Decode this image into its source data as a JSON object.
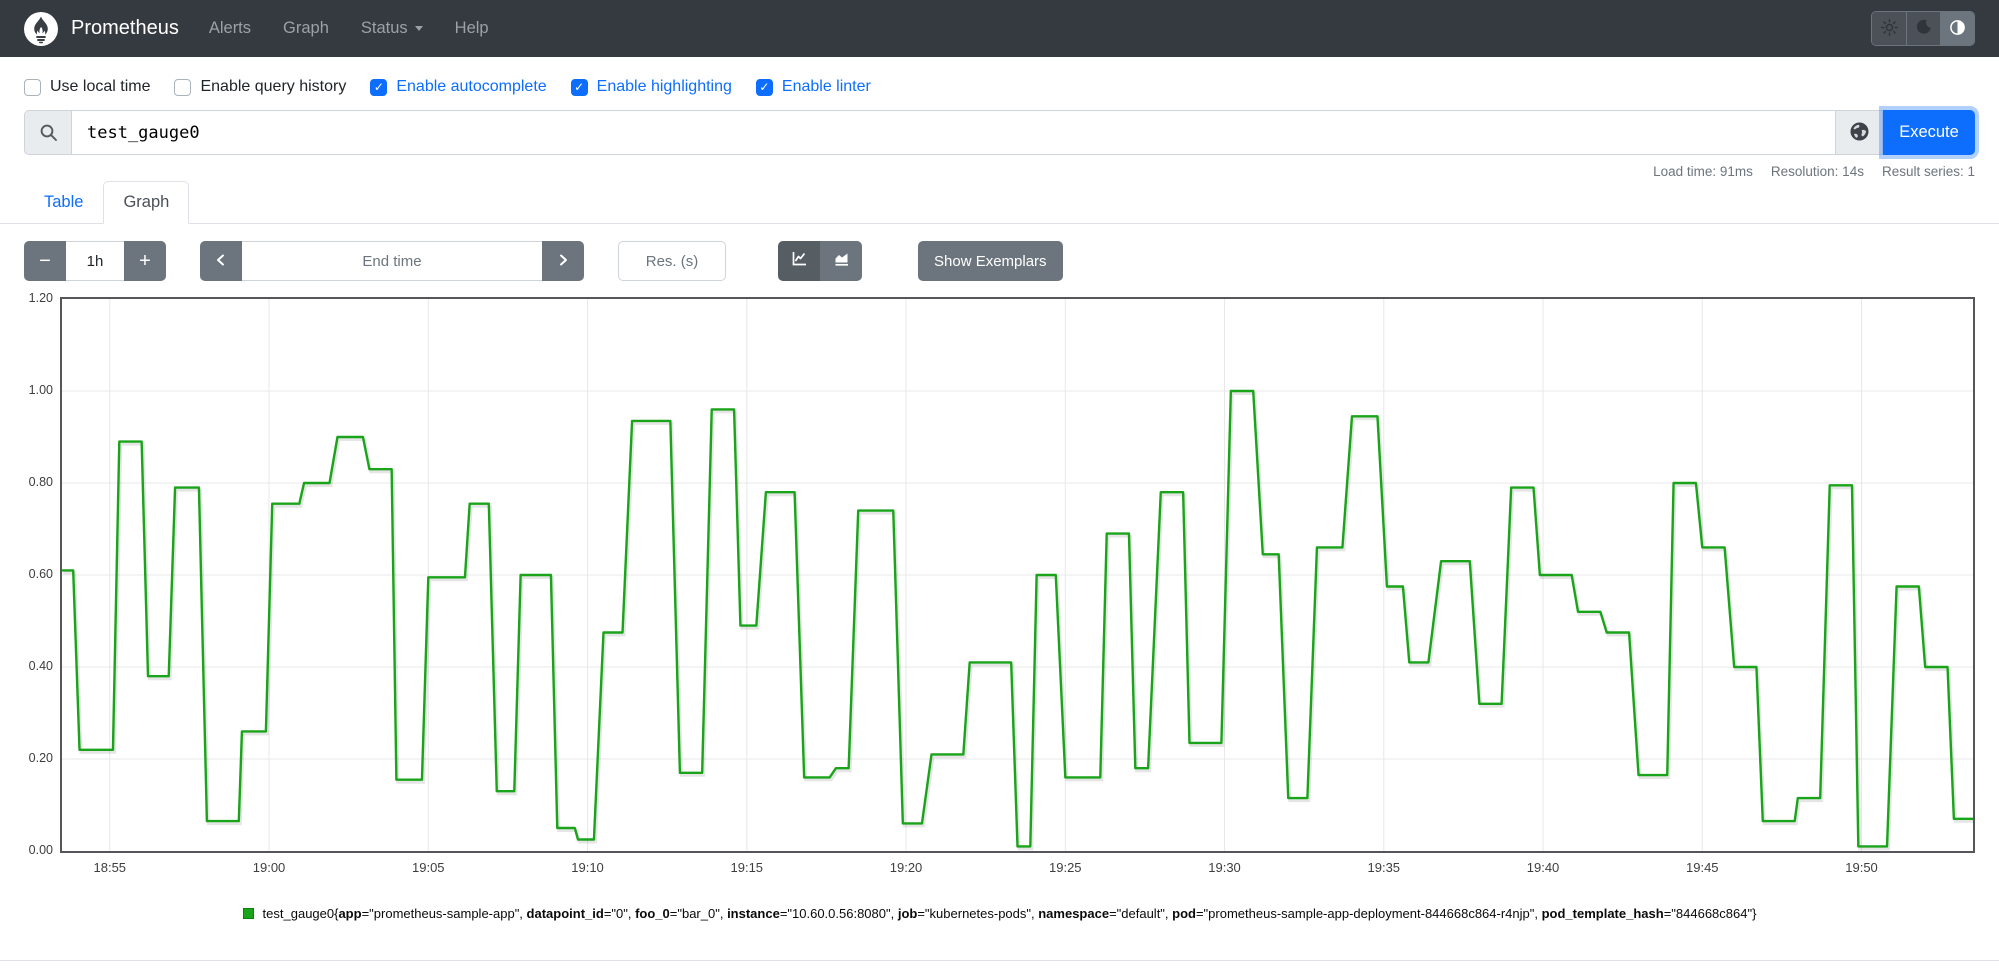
{
  "navbar": {
    "brand": "Prometheus",
    "links": [
      {
        "label": "Alerts",
        "has_caret": false
      },
      {
        "label": "Graph",
        "has_caret": false
      },
      {
        "label": "Status",
        "has_caret": true
      },
      {
        "label": "Help",
        "has_caret": false
      }
    ],
    "theme_buttons": [
      {
        "name": "light",
        "icon": "sun-icon",
        "active": false
      },
      {
        "name": "dark",
        "icon": "moon-icon",
        "active": false
      },
      {
        "name": "auto",
        "icon": "circle-half-icon",
        "active": true
      }
    ]
  },
  "options": {
    "items": [
      {
        "label": "Use local time",
        "checked": false
      },
      {
        "label": "Enable query history",
        "checked": false
      },
      {
        "label": "Enable autocomplete",
        "checked": true
      },
      {
        "label": "Enable highlighting",
        "checked": true
      },
      {
        "label": "Enable linter",
        "checked": true
      }
    ]
  },
  "query": {
    "value": "test_gauge0",
    "execute_label": "Execute"
  },
  "stats": {
    "load_time": "Load time: 91ms",
    "resolution": "Resolution: 14s",
    "result_series": "Result series: 1"
  },
  "tabs": [
    {
      "label": "Table",
      "active": false
    },
    {
      "label": "Graph",
      "active": true
    }
  ],
  "graph_controls": {
    "duration": "1h",
    "end_time_placeholder": "End time",
    "res_placeholder": "Res. (s)",
    "show_exemplars_label": "Show Exemplars"
  },
  "chart_data": {
    "type": "line",
    "line_style": "step-like gauge samples, linear interpolation",
    "line_color": "#1aa41a",
    "grid": true,
    "ylim": [
      0,
      1.2
    ],
    "y_ticks": [
      {
        "label": "0.00",
        "value": 0.0
      },
      {
        "label": "0.20",
        "value": 0.2
      },
      {
        "label": "0.40",
        "value": 0.4
      },
      {
        "label": "0.60",
        "value": 0.6
      },
      {
        "label": "0.80",
        "value": 0.8
      },
      {
        "label": "1.00",
        "value": 1.0
      },
      {
        "label": "1.20",
        "value": 1.2
      }
    ],
    "window_minutes": 60,
    "x_window_note": "1h window, left edge ~18:53.5, right edge ~19:53.5",
    "x_ticks": [
      {
        "label": "18:55",
        "t": 1.5
      },
      {
        "label": "19:00",
        "t": 6.5
      },
      {
        "label": "19:05",
        "t": 11.5
      },
      {
        "label": "19:10",
        "t": 16.5
      },
      {
        "label": "19:15",
        "t": 21.5
      },
      {
        "label": "19:20",
        "t": 26.5
      },
      {
        "label": "19:25",
        "t": 31.5
      },
      {
        "label": "19:30",
        "t": 36.5
      },
      {
        "label": "19:35",
        "t": 41.5
      },
      {
        "label": "19:40",
        "t": 46.5
      },
      {
        "label": "19:45",
        "t": 51.5
      },
      {
        "label": "19:50",
        "t": 56.5
      }
    ],
    "series": [
      {
        "name": "test_gauge0",
        "plateaus_format": "[start_minute, end_minute, value]",
        "plateaus": [
          [
            0.0,
            0.35,
            0.61
          ],
          [
            0.55,
            1.6,
            0.22
          ],
          [
            1.8,
            2.5,
            0.89
          ],
          [
            2.7,
            3.35,
            0.38
          ],
          [
            3.55,
            4.3,
            0.79
          ],
          [
            4.55,
            5.55,
            0.065
          ],
          [
            5.65,
            6.4,
            0.26
          ],
          [
            6.6,
            7.45,
            0.755
          ],
          [
            7.6,
            8.4,
            0.8
          ],
          [
            8.65,
            9.45,
            0.9
          ],
          [
            9.65,
            10.35,
            0.83
          ],
          [
            10.5,
            11.3,
            0.155
          ],
          [
            11.5,
            12.65,
            0.595
          ],
          [
            12.8,
            13.4,
            0.755
          ],
          [
            13.65,
            14.2,
            0.13
          ],
          [
            14.4,
            15.35,
            0.6
          ],
          [
            15.55,
            16.1,
            0.05
          ],
          [
            16.2,
            16.7,
            0.025
          ],
          [
            17.0,
            17.6,
            0.475
          ],
          [
            17.9,
            19.1,
            0.935
          ],
          [
            19.4,
            20.1,
            0.17
          ],
          [
            20.4,
            21.1,
            0.96
          ],
          [
            21.3,
            21.8,
            0.49
          ],
          [
            22.1,
            23.0,
            0.78
          ],
          [
            23.3,
            24.1,
            0.16
          ],
          [
            24.3,
            24.7,
            0.18
          ],
          [
            25.0,
            26.1,
            0.74
          ],
          [
            26.4,
            27.0,
            0.06
          ],
          [
            27.3,
            28.3,
            0.21
          ],
          [
            28.5,
            29.8,
            0.41
          ],
          [
            30.0,
            30.4,
            0.01
          ],
          [
            30.6,
            31.2,
            0.6
          ],
          [
            31.5,
            32.6,
            0.16
          ],
          [
            32.8,
            33.5,
            0.69
          ],
          [
            33.7,
            34.1,
            0.18
          ],
          [
            34.5,
            35.2,
            0.78
          ],
          [
            35.4,
            36.4,
            0.235
          ],
          [
            36.7,
            37.4,
            1.0
          ],
          [
            37.7,
            38.2,
            0.645
          ],
          [
            38.5,
            39.1,
            0.115
          ],
          [
            39.4,
            40.2,
            0.66
          ],
          [
            40.5,
            41.3,
            0.945
          ],
          [
            41.6,
            42.1,
            0.575
          ],
          [
            42.3,
            42.9,
            0.41
          ],
          [
            43.3,
            44.2,
            0.63
          ],
          [
            44.5,
            45.2,
            0.32
          ],
          [
            45.5,
            46.2,
            0.79
          ],
          [
            46.4,
            47.4,
            0.6
          ],
          [
            47.6,
            48.3,
            0.52
          ],
          [
            48.5,
            49.2,
            0.475
          ],
          [
            49.5,
            50.4,
            0.165
          ],
          [
            50.6,
            51.3,
            0.8
          ],
          [
            51.5,
            52.2,
            0.66
          ],
          [
            52.5,
            53.2,
            0.4
          ],
          [
            53.4,
            54.4,
            0.065
          ],
          [
            54.5,
            55.2,
            0.115
          ],
          [
            55.5,
            56.2,
            0.795
          ],
          [
            56.4,
            57.3,
            0.01
          ],
          [
            57.6,
            58.3,
            0.575
          ],
          [
            58.5,
            59.2,
            0.4
          ],
          [
            59.4,
            60.0,
            0.07
          ]
        ]
      }
    ]
  },
  "legend": {
    "metric": "test_gauge0",
    "labels": [
      [
        "app",
        "prometheus-sample-app"
      ],
      [
        "datapoint_id",
        "0"
      ],
      [
        "foo_0",
        "bar_0"
      ],
      [
        "instance",
        "10.60.0.56:8080"
      ],
      [
        "job",
        "kubernetes-pods"
      ],
      [
        "namespace",
        "default"
      ],
      [
        "pod",
        "prometheus-sample-app-deployment-844668c864-r4njp"
      ],
      [
        "pod_template_hash",
        "844668c864"
      ]
    ]
  }
}
